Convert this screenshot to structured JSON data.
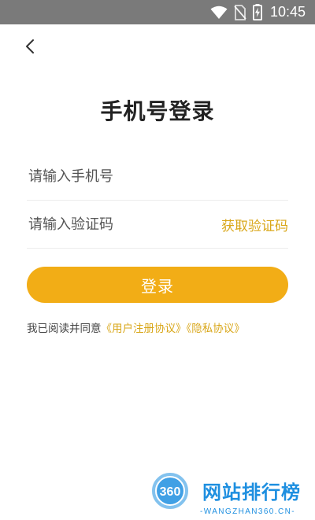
{
  "status_bar": {
    "time": "10:45",
    "icons": [
      "wifi-icon",
      "no-sim-icon",
      "battery-charging-icon"
    ]
  },
  "nav": {
    "back_icon": "chevron-left-icon"
  },
  "page": {
    "title": "手机号登录"
  },
  "form": {
    "phone_placeholder": "请输入手机号",
    "phone_value": "",
    "code_placeholder": "请输入验证码",
    "code_value": "",
    "get_code_label": "获取验证码",
    "login_label": "登录"
  },
  "agreement": {
    "prefix": "我已阅读并同意",
    "user_agreement": "《用户注册协议》",
    "privacy_policy": "《隐私协议》"
  },
  "watermark": {
    "badge": "360",
    "site_name": "网站排行榜",
    "domain": "-WANGZHAN360.CN-"
  },
  "colors": {
    "accent": "#f2ad16",
    "link": "#d9a71a",
    "status_bar": "#7a7a7a",
    "watermark_blue": "#1e8fe0"
  }
}
